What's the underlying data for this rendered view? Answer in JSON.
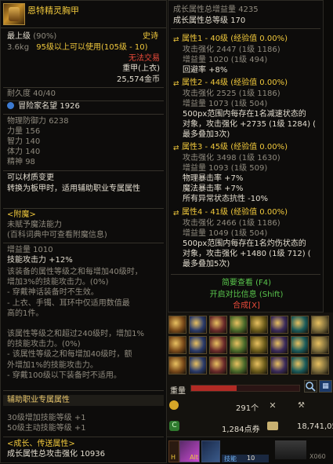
{
  "item": {
    "name": "恩特精灵胸甲",
    "level_label": "最上级",
    "level_pct": "(90%)",
    "rarity": "史诗",
    "weight": "3.6kg",
    "level_req": "95级以上可以使用(105级 - 10)",
    "trade": "无法交易",
    "armor_type": "重甲(上衣)",
    "price": "25,574金币",
    "durability": "耐久度 40/40",
    "adventurer_fame_label": "冒险家名望",
    "adventurer_fame": "1926",
    "stats": [
      {
        "label": "物理防御力",
        "value": "6238"
      },
      {
        "label": "力量",
        "value": "156"
      },
      {
        "label": "智力",
        "value": "140"
      },
      {
        "label": "体力",
        "value": "140"
      },
      {
        "label": "精神",
        "value": "98"
      }
    ],
    "material_change": "可以材质变更",
    "convert_note": "转换为板甲时，适用辅助职业专属属性",
    "enchant_header": "<附魔>",
    "enchant_state": "未赋予魔法能力",
    "enchant_hint": "(百科词典中可查看附魔信息)",
    "growth_amount": "增益量 1010",
    "skill_attack": "技能攻击力 +12%",
    "desc_lines": [
      "该装备的属性等级之和每增加40级时，",
      "增加3%的技能攻击力。(0%)",
      "- 穿戴神话装备时不生效。",
      "- 上衣、手镯、耳环中仅适用数值最",
      "高的1件。",
      "",
      "该属性等级之和超过240级时，增加1%",
      "的技能攻击力。(0%)",
      "- 该属性等级之和每增加40级时，额",
      "外增加1%的技能攻击力。",
      "- 穿戴100级以下装备时不适用。"
    ],
    "assist_header": "辅助职业专属属性",
    "assist_lines": [
      "30级增加技能等级 +1",
      "50级主动技能等级 +1"
    ],
    "growth_header": "<成长、传送属性>",
    "growth_total_label": "成长属性总攻击强化",
    "growth_total": "10936"
  },
  "growth_panel": {
    "total_boost_label": "成长属性总增益量",
    "total_boost": "4235",
    "total_level_label": "成长属性总等级",
    "total_level": "170",
    "attrs": [
      {
        "title": "属性1 - 40级 (经验值 0.00%)",
        "lines": [
          "攻击强化 2447 (1级 1186)",
          "增益量 1020 (1级 494)",
          "回避率 +8%"
        ]
      },
      {
        "title": "属性2 - 44级 (经验值 0.00%)",
        "lines": [
          "攻击强化 2525 (1级 1186)",
          "增益量 1073 (1级 504)",
          "500px范围内每存在1名减速状态的",
          "对象，攻击强化 +2735 (1级 1284) (",
          "最多叠加3次)"
        ]
      },
      {
        "title": "属性3 - 45级 (经验值 0.00%)",
        "lines": [
          "攻击强化 3498 (1级 1630)",
          "增益量 1093 (1级 509)",
          "物理暴击率 +7%",
          "魔法暴击率 +7%",
          "所有异常状态抗性 -10%"
        ]
      },
      {
        "title": "属性4 - 41级 (经验值 0.00%)",
        "lines": [
          "攻击强化 2466 (1级 1186)",
          "增益量 1049 (1级 504)",
          "500px范围内每存在1名灼伤状态的",
          "对象，攻击强化 +1480 (1级 712) (",
          "最多叠加5次)"
        ]
      }
    ],
    "simple_view": "简要查看 (F4)",
    "compare": "开启对比信息 (Shift)",
    "synthesize": "合成[X]"
  },
  "inventory": {
    "weight_label": "重量",
    "gold_count": "291个",
    "points": "1,284点券",
    "money": "18,741,05",
    "skill_label": "技能",
    "skill_level": "10",
    "alt_label": "Alt",
    "hotkey": "H",
    "bottom_right": "X060"
  },
  "colors": {
    "gold": "#f0c83c",
    "epic_orange": "#e58a2e",
    "red": "#e84a3a",
    "green": "#59c54c",
    "blue": "#6fb0f0"
  }
}
